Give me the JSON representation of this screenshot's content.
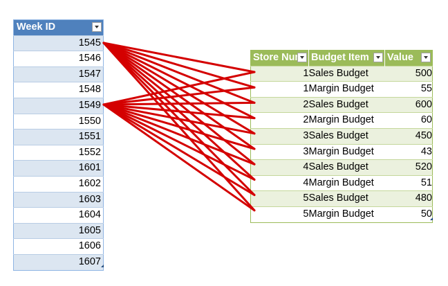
{
  "week_table": {
    "header": "Week ID",
    "rows": [
      "1545",
      "1546",
      "1547",
      "1548",
      "1549",
      "1550",
      "1551",
      "1552",
      "1601",
      "1602",
      "1603",
      "1604",
      "1605",
      "1606",
      "1607"
    ]
  },
  "budget_table": {
    "headers": [
      "Store Number",
      "Budget Item",
      "Value"
    ],
    "rows": [
      {
        "store": "1",
        "item": "Sales Budget",
        "value": "500"
      },
      {
        "store": "1",
        "item": "Margin Budget",
        "value": "55"
      },
      {
        "store": "2",
        "item": "Sales Budget",
        "value": "600"
      },
      {
        "store": "2",
        "item": "Margin Budget",
        "value": "60"
      },
      {
        "store": "3",
        "item": "Sales Budget",
        "value": "450"
      },
      {
        "store": "3",
        "item": "Margin Budget",
        "value": "43"
      },
      {
        "store": "4",
        "item": "Sales Budget",
        "value": "520"
      },
      {
        "store": "4",
        "item": "Margin Budget",
        "value": "51"
      },
      {
        "store": "5",
        "item": "Sales Budget",
        "value": "480"
      },
      {
        "store": "5",
        "item": "Margin Budget",
        "value": "50"
      }
    ]
  },
  "connector_color": "#d40000"
}
